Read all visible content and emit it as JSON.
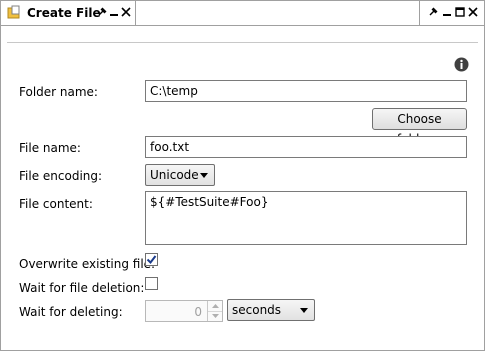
{
  "tab": {
    "title": "Create File",
    "icon": "folder-file-icon"
  },
  "fields": {
    "folder_name_label": "Folder name:",
    "folder_name_value": "C:\\temp",
    "choose_folder_label": "Choose folder...",
    "file_name_label": "File name:",
    "file_name_value": "foo.txt",
    "file_encoding_label": "File encoding:",
    "file_encoding_value": "Unicode",
    "file_content_label": "File content:",
    "file_content_value": "${#TestSuite#Foo}",
    "overwrite_label": "Overwrite existing file:",
    "overwrite_checked": true,
    "wait_deletion_label": "Wait for file deletion:",
    "wait_deletion_checked": false,
    "wait_deleting_label": "Wait for deleting:",
    "wait_deleting_value": "0",
    "wait_unit_value": "seconds"
  },
  "colors": {
    "border": "#a0a0a0",
    "check": "#1a3a8a"
  }
}
